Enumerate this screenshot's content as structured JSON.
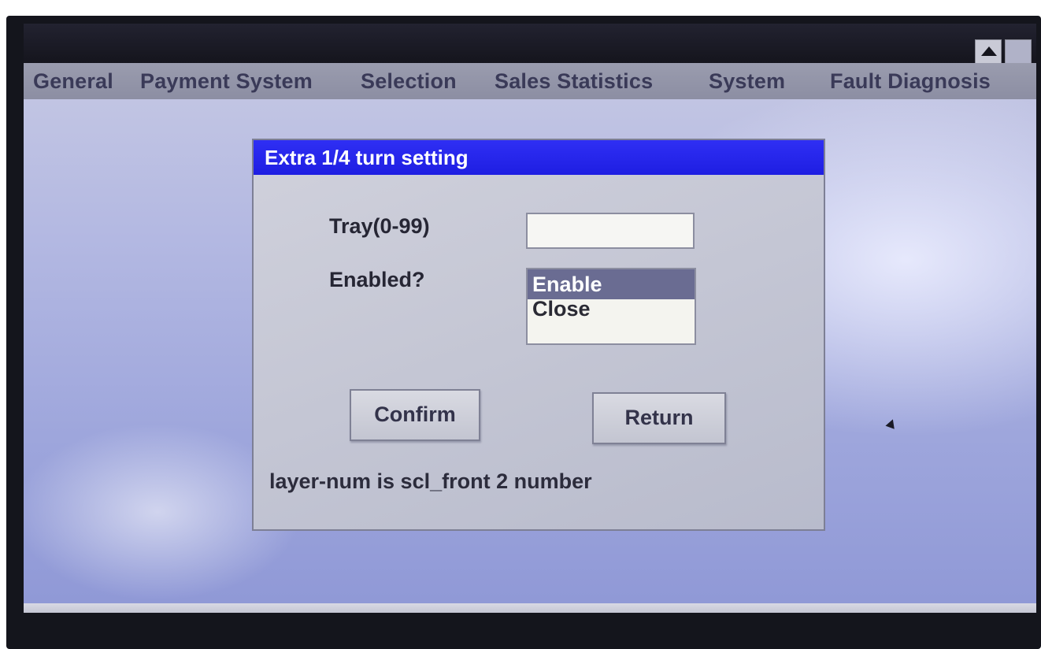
{
  "window": {
    "scroll_up_icon": "triangle-up-icon",
    "box_icon": "window-box-icon"
  },
  "menu": {
    "items": [
      {
        "label": "General"
      },
      {
        "label": "Payment System"
      },
      {
        "label": "Selection"
      },
      {
        "label": "Sales Statistics"
      },
      {
        "label": "System"
      },
      {
        "label": "Fault Diagnosis"
      }
    ]
  },
  "dialog": {
    "title": "Extra 1/4 turn setting",
    "tray": {
      "label": "Tray(0-99)",
      "value": "",
      "placeholder": ""
    },
    "enabled": {
      "label": "Enabled?",
      "options": [
        "Enable",
        "Close"
      ],
      "selected": "Enable"
    },
    "confirm_label": "Confirm",
    "return_label": "Return",
    "status": "layer-num is scl_front 2 number"
  },
  "colors": {
    "dialog_title_bg": "#1e1ee2",
    "menu_bar_bg": "#8c8ea3",
    "selected_option_bg": "#6a6c92"
  }
}
